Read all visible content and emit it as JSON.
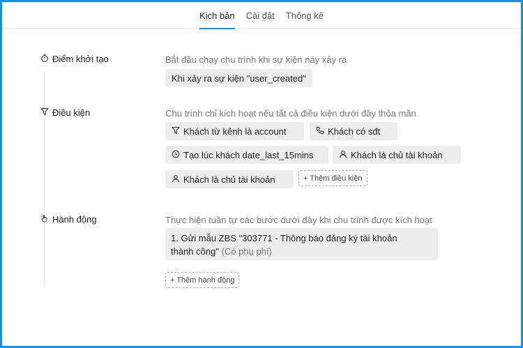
{
  "tabs": [
    {
      "label": "Kịch bản",
      "active": true
    },
    {
      "label": "Cài đặt",
      "active": false
    },
    {
      "label": "Thống kê",
      "active": false
    }
  ],
  "trigger": {
    "label": "Điểm khởi tạo",
    "description": "Bắt đầu chạy chu trình khi sự kiện này xảy ra",
    "value": "Khi xảy ra sự kiện \"user_created\""
  },
  "conditions": {
    "label": "Điều kiện",
    "description": "Chu trình chỉ kích hoạt nếu tất cả điều kiện dưới đây thỏa mãn",
    "chips": [
      {
        "icon": "filter-icon",
        "label": "Khách từ kênh là account"
      },
      {
        "icon": "phone-icon",
        "label": "Khách có sđt"
      },
      {
        "icon": "clock-icon",
        "label": "Tạo lúc khách date_last_15mins"
      },
      {
        "icon": "user-icon",
        "label": "Khách là chủ tài khoản"
      },
      {
        "icon": "user-icon",
        "label": "Khách là chủ tài khoản"
      }
    ],
    "add_label": "+ Thêm điều kiện"
  },
  "actions": {
    "label": "Hành động",
    "description": "Thực hiện tuần tự các bước dưới đây khi chu trình được kích hoạt",
    "step_text_line1": "1. Gửi mẫu ZBS \"303771 - Thông báo đăng ký tài khoản",
    "step_text_line2": "thành công\"",
    "step_fee": "(Có phụ phí)",
    "add_label": "+ Thêm hành động"
  },
  "colors": {
    "accent": "#1c8fe3",
    "chip_bg": "#ededed"
  }
}
